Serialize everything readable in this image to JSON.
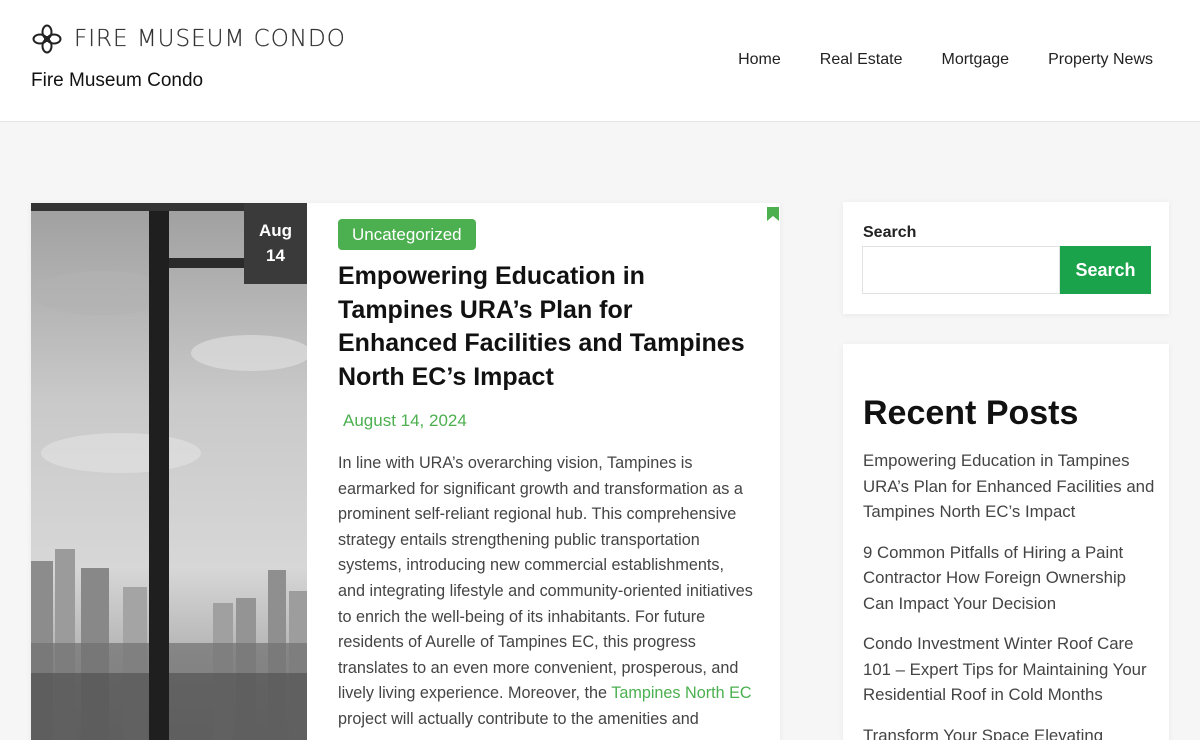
{
  "header": {
    "logo_text": "FIRE MUSEUM CONDO",
    "site_title": "Fire Museum Condo",
    "nav": [
      {
        "label": "Home"
      },
      {
        "label": "Real Estate"
      },
      {
        "label": "Mortgage"
      },
      {
        "label": "Property News"
      }
    ]
  },
  "post": {
    "badge_month": "Aug",
    "badge_day": "14",
    "category": "Uncategorized",
    "title": "Empowering Education in Tampines URA’s Plan for Enhanced Facilities and Tampines North EC’s Impact",
    "date": "August 14, 2024",
    "excerpt_before_link": "In line with URA’s overarching vision, Tampines is earmarked for significant growth and transformation as a prominent self-reliant regional hub. This comprehensive strategy entails strengthening public transportation systems, introducing new commercial establishments, and integrating lifestyle and community-oriented initiatives to enrich the well-being of its inhabitants. For future residents of Aurelle of Tampines EC, this progress translates to an even more convenient, prosperous, and lively living experience. Moreover, the ",
    "excerpt_link": "Tampines North EC",
    "excerpt_after_link": " project will actually contribute to the amenities and"
  },
  "sidebar": {
    "search_label": "Search",
    "search_button": "Search",
    "search_value": "",
    "recent_title": "Recent Posts",
    "recent_posts": [
      {
        "label": "Empowering Education in Tampines URA’s Plan for Enhanced Facilities and Tampines North EC’s Impact"
      },
      {
        "label": "9 Common Pitfalls of Hiring a Paint Contractor How Foreign Ownership Can Impact Your Decision"
      },
      {
        "label": "Condo Investment Winter Roof Care 101 – Expert Tips for Maintaining Your Residential Roof in Cold Months"
      },
      {
        "label": "Transform Your Space Elevating"
      }
    ]
  },
  "colors": {
    "accent_green": "#4caf50",
    "button_green": "#1aa34a",
    "date_badge_bg": "#3a3a3a"
  }
}
